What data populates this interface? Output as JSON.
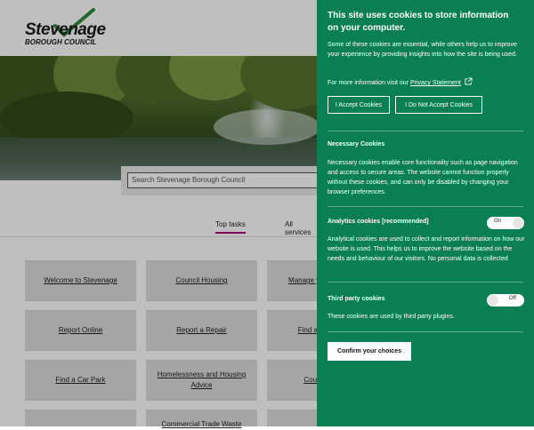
{
  "site": {
    "logo": {
      "name": "Stevenage",
      "sub": "BOROUGH COUNCIL"
    },
    "search": {
      "placeholder": "Search Stevenage Borough Council"
    },
    "tabs": [
      {
        "label": "Top tasks"
      },
      {
        "label": "All services"
      }
    ],
    "tiles": [
      {
        "label": "Welcome to Stevenage"
      },
      {
        "label": "Council Housing"
      },
      {
        "label": "Manage your account"
      },
      {
        "label": "Report Online"
      },
      {
        "label": "Report a Repair"
      },
      {
        "label": "Find a Planning"
      },
      {
        "label": "Find a Car Park"
      },
      {
        "label": "Homelessness and Housing Advice"
      },
      {
        "label": "Council and"
      },
      {
        "label": ""
      },
      {
        "label": "Commercial Trade Waste"
      }
    ]
  },
  "cookies": {
    "title": "This site uses cookies to store information on your computer.",
    "intro": "Some of these cookies are essential, while others help us to improve your experience by providing insights into how the site is being used.",
    "more_info_prefix": "For more information visit our",
    "privacy_link": "Privacy Statement",
    "accept_label": "I Accept Cookies",
    "decline_label": "I Do Not Accept Cookies",
    "necessary_title": "Necessary Cookies",
    "necessary_text": "Necessary cookies enable core functionality such as page navigation and access to secure areas. The website cannot function properly without these cookies, and can only be disabled by changing your browser preferences.",
    "analytics_title": "Analytics cookies [recommended]",
    "analytics_state": "On",
    "analytics_text": "Analytical cookies are used to collect and report information on how our website is used. This helps us to improve the website based on the needs and behaviour of our visitors. No personal data is collected",
    "third_party_title": "Third party cookies",
    "third_party_state": "Off",
    "third_party_text": "These cookies are used by third party plugins.",
    "confirm_label": "Confirm your choices"
  },
  "colors": {
    "panel": "#0a7f53",
    "accent": "#b5007a"
  }
}
